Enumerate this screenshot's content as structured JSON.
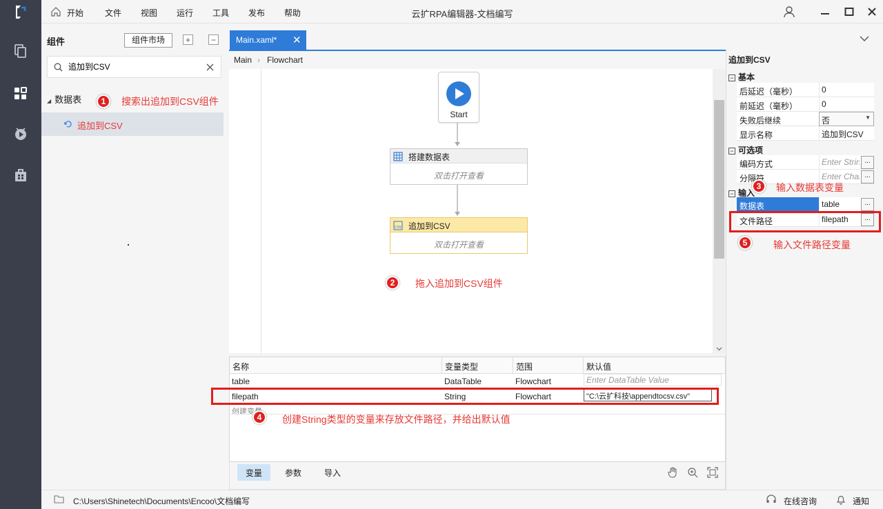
{
  "window": {
    "title": "云扩RPA编辑器-文档编写",
    "menu": [
      "开始",
      "文件",
      "视图",
      "运行",
      "工具",
      "发布",
      "帮助"
    ]
  },
  "components": {
    "title": "组件",
    "market_button": "组件市场",
    "search_value": "追加到CSV",
    "tree_category": "数据表",
    "tree_item": "追加到CSV"
  },
  "editor": {
    "tab_label": "Main.xaml*",
    "breadcrumb": [
      "Main",
      "Flowchart"
    ],
    "start_label": "Start",
    "nodes": [
      {
        "title": "搭建数据表",
        "body": "双击打开查看"
      },
      {
        "title": "追加到CSV",
        "body": "双击打开查看"
      }
    ]
  },
  "variables": {
    "headers": [
      "名称",
      "变量类型",
      "范围",
      "默认值"
    ],
    "rows": [
      {
        "name": "table",
        "type": "DataTable",
        "scope": "Flowchart",
        "default": "Enter DataTable Value"
      },
      {
        "name": "filepath",
        "type": "String",
        "scope": "Flowchart",
        "default": "\"C:\\云扩科技\\appendtocsv.csv\""
      }
    ],
    "create_hint": "创建变量",
    "tabs": [
      "变量",
      "参数",
      "导入"
    ]
  },
  "properties": {
    "title": "追加到CSV",
    "sections": {
      "basic": "基本",
      "optional": "可选项",
      "input": "输入"
    },
    "basic_rows": [
      {
        "label": "后延迟（毫秒）",
        "value": "0"
      },
      {
        "label": "前延迟（毫秒）",
        "value": "0"
      },
      {
        "label": "失败后继续",
        "value": "否"
      },
      {
        "label": "显示名称",
        "value": "追加到CSV"
      }
    ],
    "optional_rows": [
      {
        "label": "编码方式",
        "placeholder": "Enter String"
      },
      {
        "label": "分隔符",
        "placeholder": "Enter Char"
      }
    ],
    "input_rows": [
      {
        "label": "数据表",
        "value": "table"
      },
      {
        "label": "文件路径",
        "value": "filepath"
      }
    ],
    "dots_label": "..."
  },
  "annotations": [
    {
      "num": "1",
      "text": "搜索出追加到CSV组件"
    },
    {
      "num": "2",
      "text": "拖入追加到CSV组件"
    },
    {
      "num": "3",
      "text": "输入数据表变量"
    },
    {
      "num": "4",
      "text": "创建String类型的变量来存放文件路径，并给出默认值"
    },
    {
      "num": "5",
      "text": "输入文件路径变量"
    }
  ],
  "status": {
    "path": "C:\\Users\\Shinetech\\Documents\\Encoo\\文档编写",
    "online": "在线咨询",
    "notify": "通知"
  },
  "colors": {
    "accent": "#2f7bd8",
    "annotation": "#e53935",
    "rail": "#3a3f4b",
    "node2_header": "#fde9a6"
  }
}
